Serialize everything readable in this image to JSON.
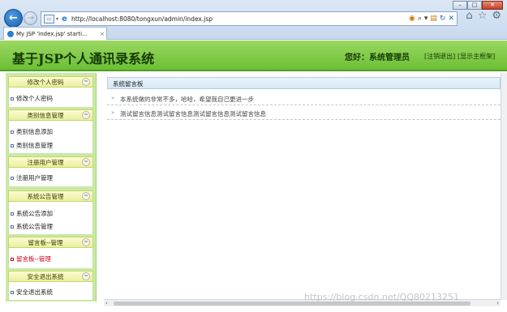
{
  "browser": {
    "url": "http://localhost:8080/tongxun/admin/index.jsp",
    "tab_label": "My JSP 'index.jsp' starti...",
    "tab_close": "×",
    "window_controls": {
      "minimize": "–",
      "maximize": "□",
      "close": "✕"
    },
    "icons": [
      "back-icon",
      "forward-icon",
      "page-icon",
      "ie-icon",
      "compat-icon",
      "search-icon",
      "refresh-icon",
      "stop-icon",
      "home-icon",
      "favorites-icon",
      "settings-icon"
    ]
  },
  "header": {
    "title": "基于JSP个人通讯录系统",
    "greeting": "您好：系统管理员",
    "logout_link": "[注销退出]",
    "home_link": "[显示主框架]"
  },
  "sidebar": {
    "sections": [
      {
        "title": "修改个人密码",
        "items": [
          {
            "label": "修改个人密码",
            "active": false
          }
        ]
      },
      {
        "title": "类别信息管理",
        "items": [
          {
            "label": "类别信息添加",
            "active": false
          },
          {
            "label": "类别信息管理",
            "active": false
          }
        ]
      },
      {
        "title": "注册用户管理",
        "items": [
          {
            "label": "注册用户管理",
            "active": false
          }
        ]
      },
      {
        "title": "系统公告管理",
        "items": [
          {
            "label": "系统公告添加",
            "active": false
          },
          {
            "label": "系统公告管理",
            "active": false
          }
        ]
      },
      {
        "title": "留言板--管理",
        "items": [
          {
            "label": "留言板--管理",
            "active": true
          }
        ]
      },
      {
        "title": "安全退出系统",
        "items": [
          {
            "label": "安全退出系统",
            "active": false
          }
        ]
      }
    ],
    "collapse_glyph": "≈"
  },
  "main": {
    "panel_title": "系统留言板",
    "messages": [
      "本系统做的非常不多，哈哈，希望我自己更进一步",
      "测试留言信息测试留言信息测试留言信息测试留言信息"
    ],
    "row_arrow": "»"
  },
  "scrollbar": {
    "left_arrow": "‹",
    "right_arrow": "›"
  },
  "watermark": "https://blog.csdn.net/QQ80213251",
  "colors": {
    "header_green": "#6cbf35",
    "sidebar_green": "#c9e9a5",
    "active_red": "#d2001a"
  }
}
